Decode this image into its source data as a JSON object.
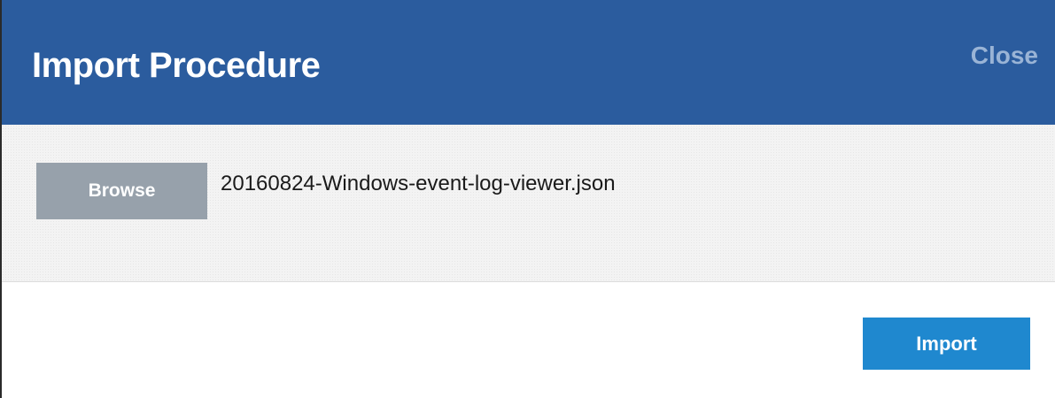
{
  "dialog": {
    "title": "Import Procedure",
    "close_label": "Close"
  },
  "content": {
    "browse_label": "Browse",
    "selected_file": "20160824-Windows-event-log-viewer.json"
  },
  "footer": {
    "import_label": "Import"
  },
  "colors": {
    "header_bg": "#2b5c9e",
    "close_text": "#9ab4d6",
    "browse_bg": "#97a1ab",
    "import_bg": "#1f88cf"
  }
}
